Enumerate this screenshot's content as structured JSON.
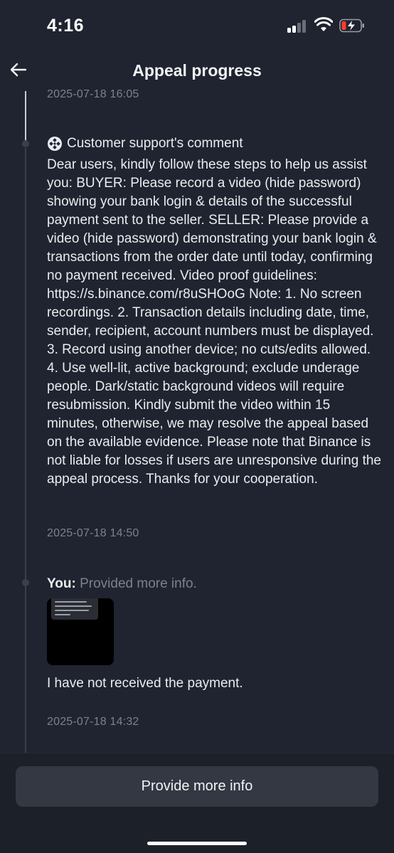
{
  "status_bar": {
    "time": "4:16"
  },
  "header": {
    "title": "Appeal progress",
    "back_icon": "arrow-left-icon"
  },
  "timeline": [
    {
      "kind": "timestamp_only",
      "timestamp": "2025-07-18 16:05"
    },
    {
      "kind": "support_comment",
      "icon": "binance-logo-icon",
      "title": "Customer support's comment",
      "body": "Dear users, kindly follow these steps to help us assist you:  BUYER: Please record a video (hide password) showing your bank login & details of the successful payment sent to the seller.  SELLER: Please provide a video (hide password) demonstrating your bank login & transactions from the order date until today, confirming no payment received.  Video proof guidelines: https://s.binance.com/r8uSHOoG   Note:  1. No screen recordings. 2. Transaction details including date, time, sender, recipient, account numbers must be displayed. 3. Record using another device; no cuts/edits allowed. 4. Use well-lit, active background; exclude underage people. Dark/static background videos will require resubmission.  Kindly submit the video within 15 minutes, otherwise, we may resolve the appeal based on the available evidence. Please note that Binance is not liable for losses if users are unresponsive during the appeal process.  Thanks for your cooperation.",
      "timestamp": "2025-07-18 14:50"
    },
    {
      "kind": "user_info",
      "label": "You:",
      "action": "Provided more info.",
      "attachment": "screenshot-thumbnail",
      "message": "I have not received the payment.",
      "timestamp": "2025-07-18 14:32"
    }
  ],
  "footer": {
    "button_label": "Provide more info"
  },
  "colors": {
    "background": "#1f2430",
    "text": "#eaecef",
    "muted": "#7d818c",
    "button": "#333843"
  }
}
